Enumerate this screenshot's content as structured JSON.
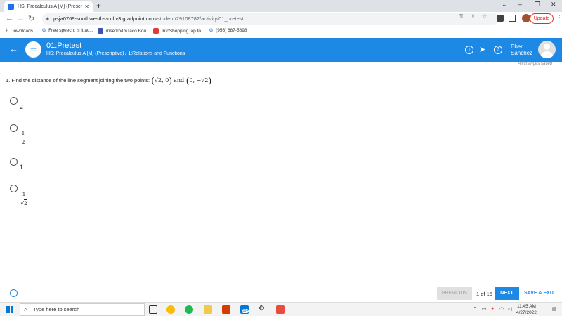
{
  "browser": {
    "tab_title": "HS: Precalculus A [M] (Prescriptive)",
    "tab_close": "✕",
    "new_tab": "+",
    "window_controls": [
      "⌄",
      "–",
      "❐",
      "✕"
    ],
    "url_host": "psja0769-southwesths-ccl.v3.gradpoint.com",
    "url_path": "/student/29108782/activity/01_pretest",
    "update_label": "Update"
  },
  "bookmarks": [
    {
      "label": "Downloads",
      "icon": "download-icon",
      "color": "#444444"
    },
    {
      "label": "Free speech: is it ac...",
      "icon": "google-icon",
      "color": "#4285f4"
    },
    {
      "label": "mse:kb/ImTaco Bou...",
      "icon": "doc-icon",
      "color": "#3f51b5"
    },
    {
      "label": "InfoShoppingTap to...",
      "icon": "youtube-icon",
      "color": "#e53935"
    },
    {
      "label": "(956) 687-5898",
      "icon": "google-icon",
      "color": "#4285f4"
    }
  ],
  "header": {
    "title": "01:Pretest",
    "subtitle": "HS: Precalculus A [M] (Prescriptive) / 1:Relations and Functions",
    "user_first": "Eber",
    "user_last": "Sanchez",
    "save_status": "All changes saved"
  },
  "question": {
    "text": "1. Find the distance of the line segment joining the two points:",
    "p1_open": "(",
    "p1_rad": "√",
    "p1_rad_arg": "2",
    "p1_rest": ", 0",
    "p1_close": ")",
    "joiner": " and ",
    "p2_open": "(",
    "p2_pre": "0, −",
    "p2_rad": "√",
    "p2_rad_arg": "2",
    "p2_close": ")"
  },
  "answers": [
    {
      "value": "2"
    },
    {
      "numerator": "1",
      "denominator": "2"
    },
    {
      "value": "1"
    },
    {
      "numerator": "1",
      "denominator_rad": "√",
      "denominator_arg": "2"
    }
  ],
  "footer": {
    "previous_label": "PREVIOUS",
    "page_counter": "1 of 15",
    "next_label": "NEXT",
    "save_exit_label": "SAVE & EXIT"
  },
  "taskbar": {
    "search_placeholder": "Type here to search",
    "time": "11:45 AM",
    "date": "4/27/2022",
    "badge": "99+"
  }
}
